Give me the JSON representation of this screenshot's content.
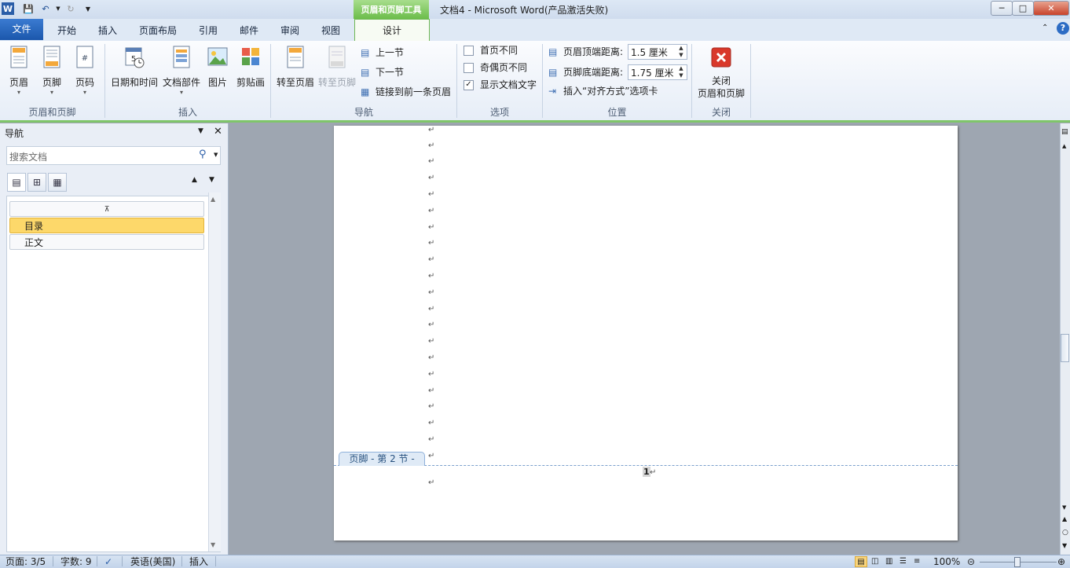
{
  "window": {
    "title": "文档4 - Microsoft Word(产品激活失败)",
    "context_tools_label": "页眉和页脚工具"
  },
  "tabs": {
    "file": "文件",
    "items": [
      "开始",
      "插入",
      "页面布局",
      "引用",
      "邮件",
      "审阅",
      "视图"
    ],
    "design": "设计"
  },
  "ribbon": {
    "group_header_footer": {
      "label": "页眉和页脚",
      "header": "页眉",
      "footer": "页脚",
      "page_number": "页码"
    },
    "group_insert": {
      "label": "插入",
      "datetime": "日期和时间",
      "quick_parts": "文档部件",
      "picture": "图片",
      "clip_art": "剪贴画"
    },
    "group_navigation": {
      "label": "导航",
      "goto_header": "转至页眉",
      "goto_footer": "转至页脚",
      "previous": "上一节",
      "next": "下一节",
      "link_previous": "链接到前一条页眉"
    },
    "group_options": {
      "label": "选项",
      "different_first": "首页不同",
      "different_odd_even": "奇偶页不同",
      "show_doc_text": "显示文档文字",
      "different_first_checked": false,
      "different_odd_even_checked": false,
      "show_doc_text_checked": true
    },
    "group_position": {
      "label": "位置",
      "header_from_top_label": "页眉顶端距离:",
      "header_from_top_value": "1.5 厘米",
      "footer_from_bottom_label": "页脚底端距离:",
      "footer_from_bottom_value": "1.75 厘米",
      "insert_align_tab": "插入“对齐方式”选项卡"
    },
    "group_close": {
      "label": "关闭",
      "close_line1": "关闭",
      "close_line2": "页眉和页脚"
    }
  },
  "nav_pane": {
    "title": "导航",
    "search_placeholder": "搜索文档",
    "items": [
      "目录",
      "正文"
    ],
    "selected_index": 0
  },
  "document": {
    "paragraph_mark": "↵",
    "footer_tag": "页脚 - 第 2 节 -",
    "page_number": "1"
  },
  "status_bar": {
    "page": "页面: 3/5",
    "words": "字数: 9",
    "language": "英语(美国)",
    "mode": "插入",
    "zoom": "100%"
  },
  "colors": {
    "file_tab": "#2a66be",
    "context_tools": "#6cbd4b",
    "nav_selected": "#fdd86a"
  }
}
